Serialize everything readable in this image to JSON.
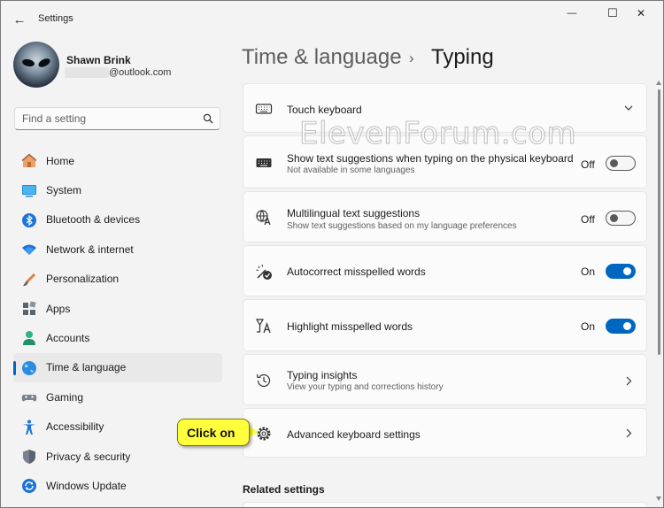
{
  "window": {
    "app_title": "Settings",
    "minimize_glyph": "—",
    "maximize_glyph": "☐",
    "close_glyph": "✕",
    "back_glyph": "←"
  },
  "profile": {
    "name": "Shawn Brink",
    "email_visible": "@outlook.com"
  },
  "search": {
    "placeholder": "Find a setting",
    "value": ""
  },
  "nav": {
    "items": [
      {
        "label": "Home",
        "icon": "home-icon"
      },
      {
        "label": "System",
        "icon": "system-icon"
      },
      {
        "label": "Bluetooth & devices",
        "icon": "bluetooth-icon"
      },
      {
        "label": "Network & internet",
        "icon": "wifi-icon"
      },
      {
        "label": "Personalization",
        "icon": "brush-icon"
      },
      {
        "label": "Apps",
        "icon": "apps-icon"
      },
      {
        "label": "Accounts",
        "icon": "accounts-icon"
      },
      {
        "label": "Time & language",
        "icon": "globe-icon",
        "active": true
      },
      {
        "label": "Gaming",
        "icon": "gamepad-icon"
      },
      {
        "label": "Accessibility",
        "icon": "accessibility-icon"
      },
      {
        "label": "Privacy & security",
        "icon": "shield-icon"
      },
      {
        "label": "Windows Update",
        "icon": "update-icon"
      }
    ]
  },
  "header": {
    "parent": "Time & language",
    "separator": "›",
    "current": "Typing"
  },
  "settings": [
    {
      "title": "Touch keyboard",
      "subtitle": "",
      "control": "expand",
      "icon": "keyboard-icon"
    },
    {
      "title": "Show text suggestions when typing on the physical keyboard",
      "subtitle": "Not available in some languages",
      "control": "toggle",
      "state": "Off",
      "icon": "keyboard-icon"
    },
    {
      "title": "Multilingual text suggestions",
      "subtitle": "Show text suggestions based on my language preferences",
      "control": "toggle",
      "state": "Off",
      "icon": "language-icon"
    },
    {
      "title": "Autocorrect misspelled words",
      "subtitle": "",
      "control": "toggle",
      "state": "On",
      "icon": "autocorrect-icon"
    },
    {
      "title": "Highlight misspelled words",
      "subtitle": "",
      "control": "toggle",
      "state": "On",
      "icon": "spellcheck-icon"
    },
    {
      "title": "Typing insights",
      "subtitle": "View your typing and corrections history",
      "control": "chevron",
      "icon": "history-icon"
    },
    {
      "title": "Advanced keyboard settings",
      "subtitle": "",
      "control": "chevron",
      "icon": "gear-icon"
    }
  ],
  "related": {
    "heading": "Related settings"
  },
  "watermark": "ElevenForum.com",
  "callout": {
    "text": "Click on"
  },
  "colors": {
    "accent": "#0067c0",
    "callout": "#ffff3c"
  }
}
